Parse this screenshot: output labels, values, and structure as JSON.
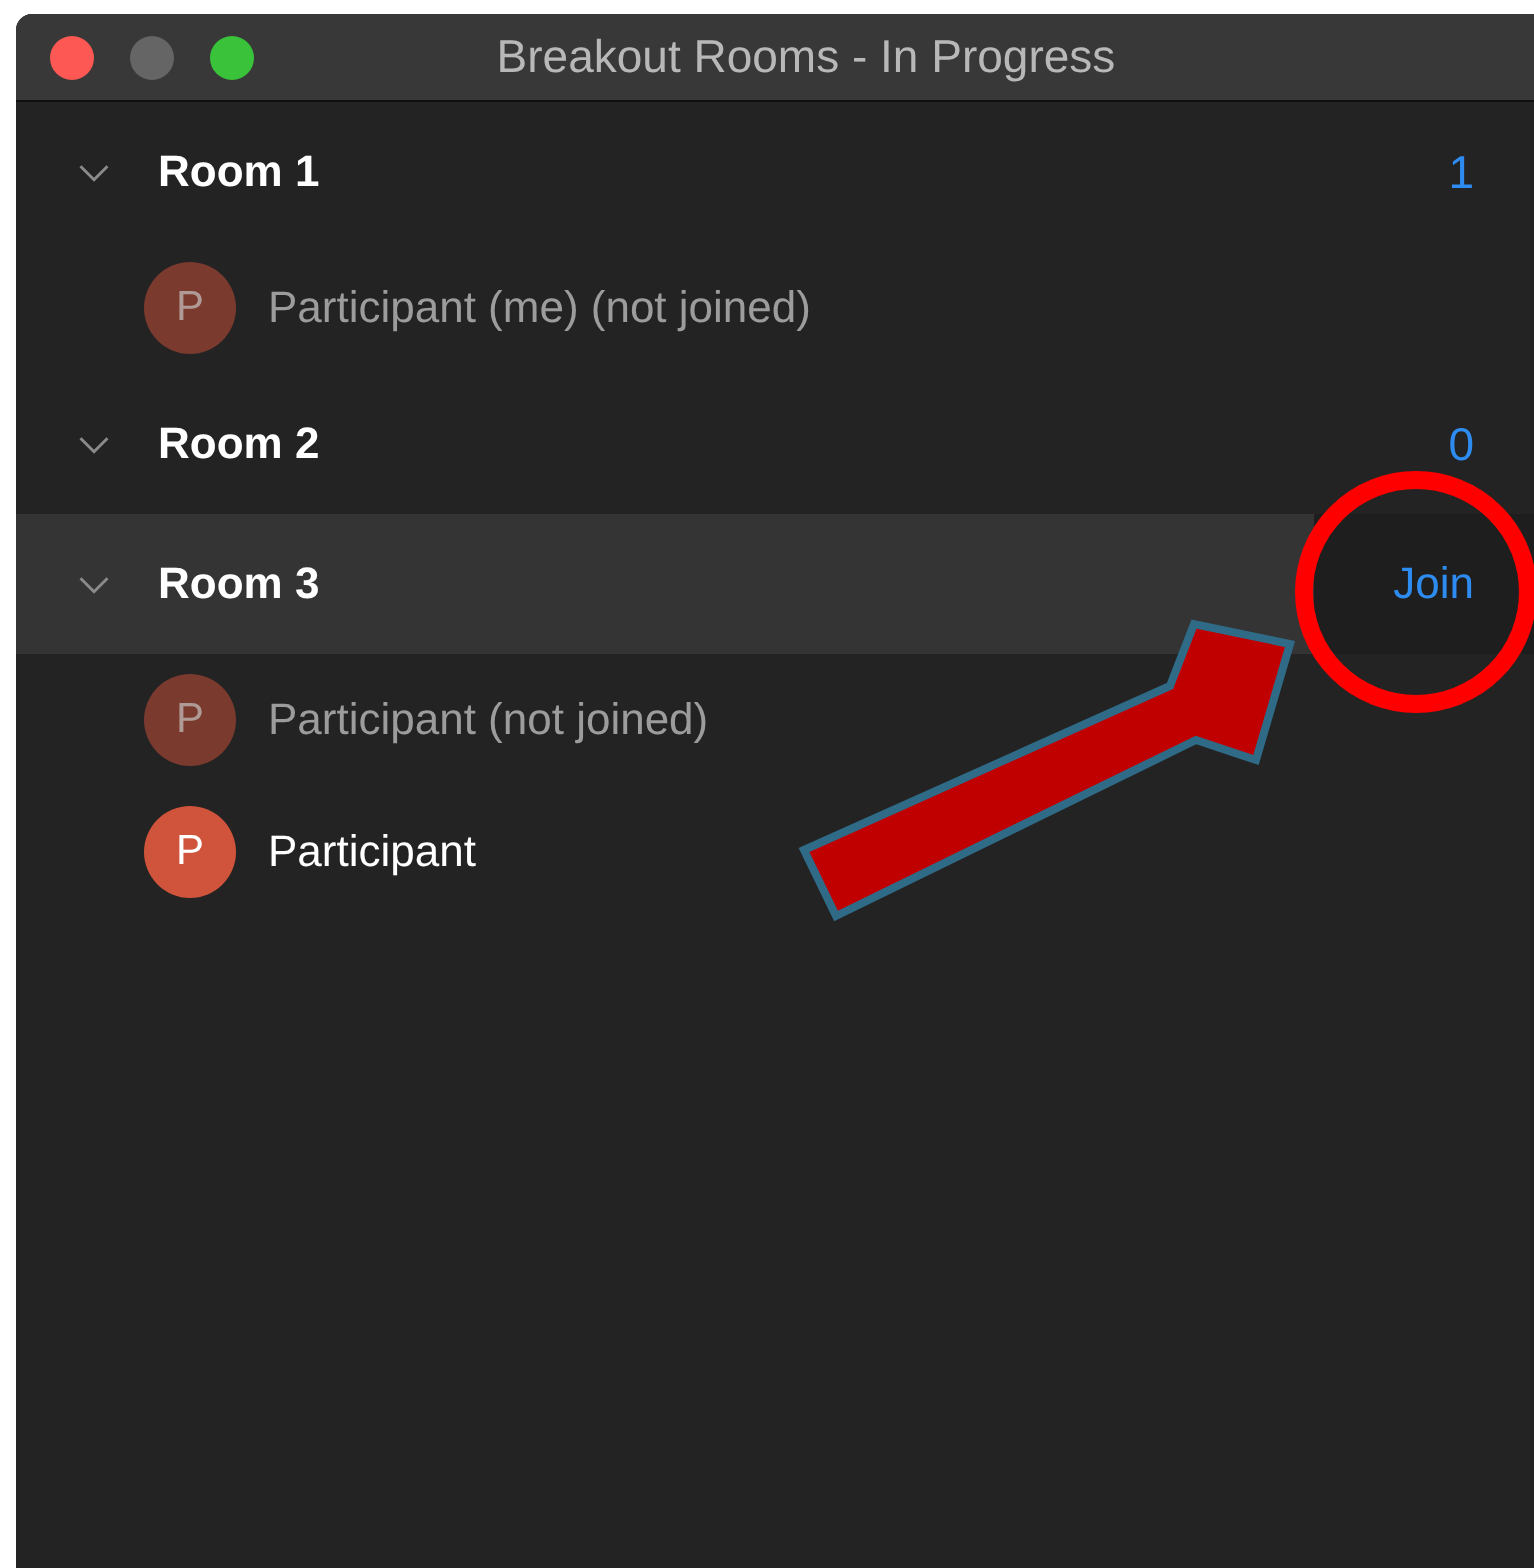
{
  "window": {
    "title": "Breakout Rooms - In Progress"
  },
  "rooms": [
    {
      "name": "Room 1",
      "count": "1",
      "highlighted": false,
      "expanded": true,
      "participants": [
        {
          "initial": "P",
          "name": "Participant (me) (not joined)",
          "joined": false
        }
      ]
    },
    {
      "name": "Room 2",
      "count": "0",
      "highlighted": false,
      "expanded": true
    },
    {
      "name": "Room 3",
      "action": "Join",
      "highlighted": true,
      "expanded": true,
      "participants": [
        {
          "initial": "P",
          "name": "Participant (not joined)",
          "joined": false
        },
        {
          "initial": "P",
          "name": "Participant",
          "joined": true
        }
      ]
    }
  ]
}
